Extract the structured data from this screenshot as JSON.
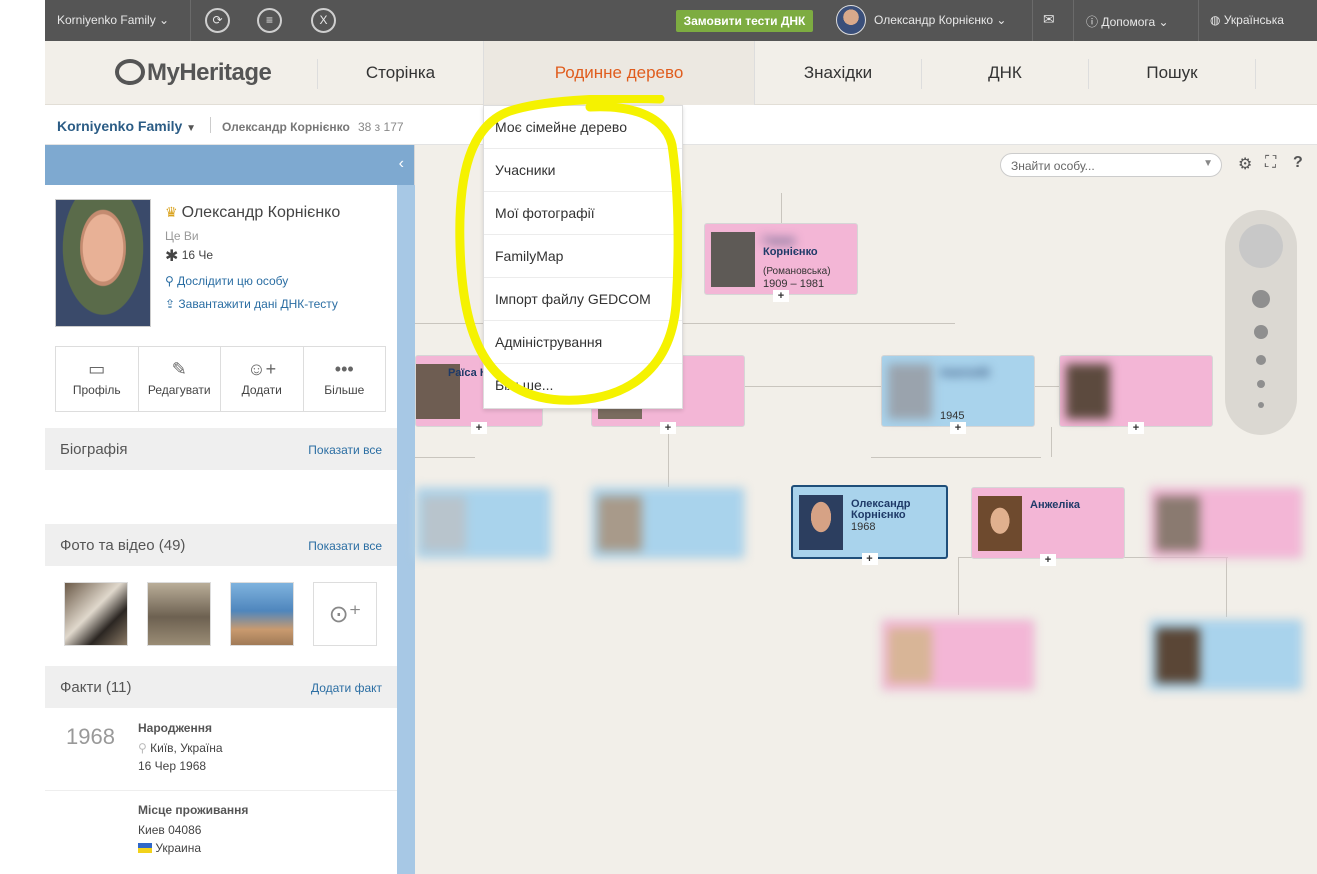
{
  "topbar": {
    "site_name": "Korniyenko Family",
    "dna_button": "Замовити тести ДНК",
    "user_name": "Олександр Корнієнко",
    "help": "Допомога",
    "language": "Українська"
  },
  "nav": {
    "logo": "MyHeritage",
    "items": [
      "Сторінка",
      "Родинне дерево",
      "Знахідки",
      "ДНК",
      "Пошук"
    ],
    "active": "Родинне дерево"
  },
  "subbar": {
    "family": "Korniyenko Family",
    "person": "Олександр Корнієнко",
    "count": "38 з 177"
  },
  "profile": {
    "name": "Олександр Корнієнко",
    "tag": "Це Ви",
    "birth": "16 Че",
    "explore_link": "Дослідити цю особу",
    "dna_link": "Завантажити дані ДНК-тесту",
    "actions": [
      "Профіль",
      "Редагувати",
      "Додати",
      "Більше"
    ]
  },
  "biography": {
    "title": "Біографія",
    "link": "Показати все"
  },
  "photos": {
    "title": "Фото та відео (49)",
    "link": "Показати все"
  },
  "facts": {
    "title": "Факти (11)",
    "link": "Додати факт",
    "items": [
      {
        "year": "1968",
        "title": "Народження",
        "place": "Київ, Україна",
        "date": "16 Чер 1968"
      },
      {
        "title": "Місце проживання",
        "address": "Киев 04086",
        "country": "Украина"
      }
    ]
  },
  "tree": {
    "search_placeholder": "Знайти особу...",
    "cards": {
      "top_name": "Корнієнко",
      "top_maiden": "(Романовська)",
      "top_years": "1909 – 1981",
      "raisa": "Раїса К",
      "anatoliy_year": "1945",
      "main_name": "Олександр Корнієнко",
      "main_year": "1968",
      "spouse_name": "Анжеліка"
    }
  },
  "dropdown": {
    "items": [
      "Моє сімейне дерево",
      "Учасники",
      "Мої фотографії",
      "FamilyMap",
      "Імпорт файлу GEDCOM",
      "Адміністрування",
      "Більше..."
    ]
  },
  "colors": {
    "accent": "#e05d1e",
    "female_card": "#f3b6d6",
    "male_card": "#a9d3ec",
    "dna_green": "#7dac41",
    "highlight": "#f5f200"
  }
}
